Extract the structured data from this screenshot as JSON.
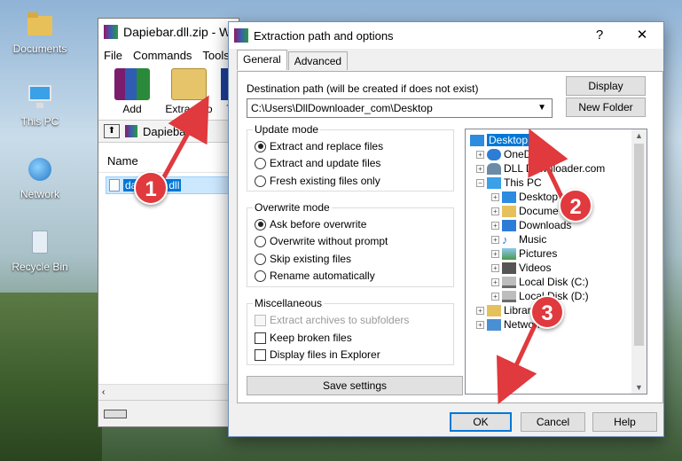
{
  "desktop": {
    "icons": [
      {
        "label": "Documents",
        "icon": "folder-documents-icon"
      },
      {
        "label": "This PC",
        "icon": "computer-icon"
      },
      {
        "label": "Network",
        "icon": "network-icon"
      },
      {
        "label": "Recycle Bin",
        "icon": "recycle-bin-icon"
      }
    ]
  },
  "winrar": {
    "title": "Dapiebar.dll.zip - W",
    "menu": [
      "File",
      "Commands",
      "Tools"
    ],
    "toolbar": {
      "add": "Add",
      "extract_to": "Extract To",
      "partial": "T"
    },
    "address": "Dapiebar.dll",
    "column_name": "Name",
    "file_name": "dapiebar.dll"
  },
  "dialog": {
    "title": "Extraction path and options",
    "help_glyph": "?",
    "close_glyph": "✕",
    "tabs": [
      "General",
      "Advanced"
    ],
    "dest_label": "Destination path (will be created if does not exist)",
    "dest_value": "C:\\Users\\DllDownloader_com\\Desktop",
    "display_button": "Display",
    "new_folder_button": "New Folder",
    "update_mode": {
      "title": "Update mode",
      "options": [
        "Extract and replace files",
        "Extract and update files",
        "Fresh existing files only"
      ],
      "selected": 0
    },
    "overwrite_mode": {
      "title": "Overwrite mode",
      "options": [
        "Ask before overwrite",
        "Overwrite without prompt",
        "Skip existing files",
        "Rename automatically"
      ],
      "selected": 0
    },
    "misc": {
      "title": "Miscellaneous",
      "options": [
        "Extract archives to subfolders",
        "Keep broken files",
        "Display files in Explorer"
      ]
    },
    "save_settings": "Save settings",
    "ok": "OK",
    "cancel": "Cancel",
    "help": "Help",
    "tree": [
      "Desktop",
      "OneD",
      "DLL Downloader.com",
      "This PC",
      "Desktop",
      "Docume",
      "Downloads",
      "Music",
      "Pictures",
      "Videos",
      "Local Disk (C:)",
      "Local Disk (D:)",
      "Librari",
      "Network"
    ]
  },
  "markers": [
    "1",
    "2",
    "3"
  ],
  "colors": {
    "marker": "#e0393e",
    "selection": "#0078d7"
  }
}
